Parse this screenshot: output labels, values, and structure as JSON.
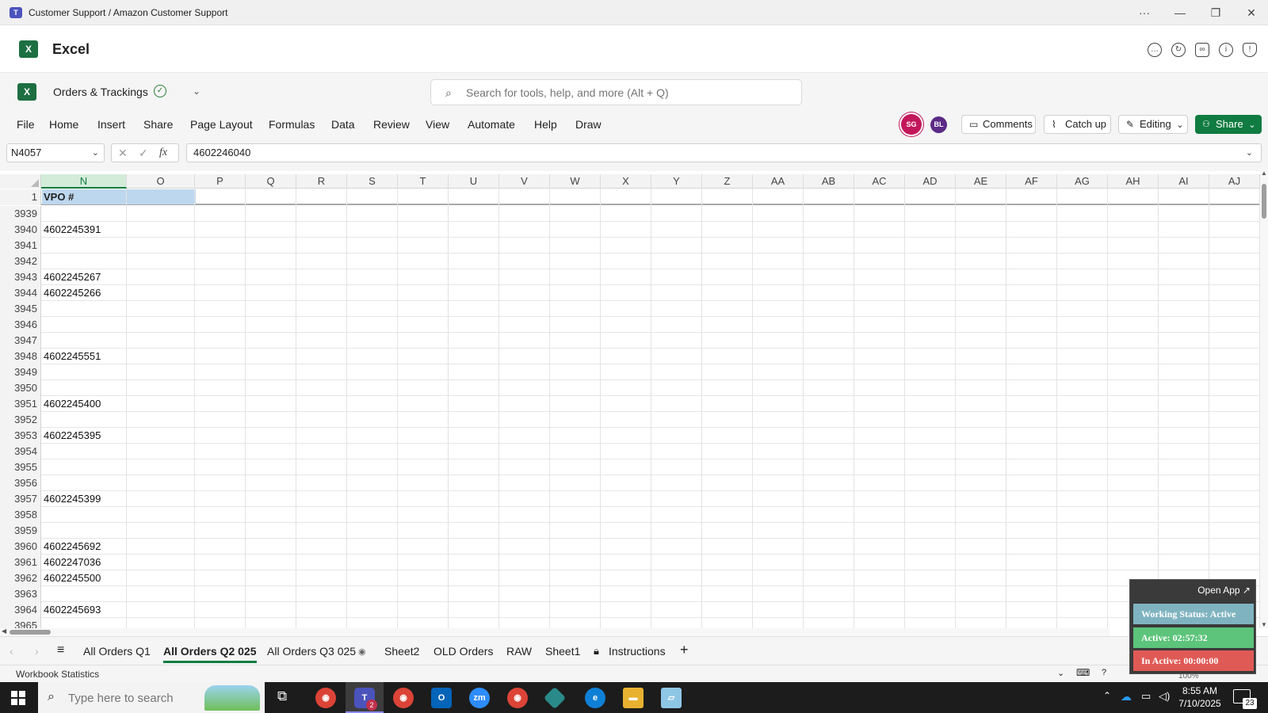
{
  "window": {
    "title": "Customer Support / Amazon Customer Support"
  },
  "app": {
    "name": "Excel"
  },
  "doc": {
    "name": "Orders & Trackings"
  },
  "search": {
    "placeholder": "Search for tools, help, and more (Alt + Q)"
  },
  "ribbon": {
    "tabs": [
      "File",
      "Home",
      "Insert",
      "Share",
      "Page Layout",
      "Formulas",
      "Data",
      "Review",
      "View",
      "Automate",
      "Help",
      "Draw"
    ],
    "avatars": [
      "SG",
      "BL"
    ],
    "comments": "Comments",
    "catchup": "Catch up",
    "editing": "Editing",
    "share": "Share"
  },
  "formula_bar": {
    "name_box": "N4057",
    "value": "4602246040",
    "fx": "fx"
  },
  "grid": {
    "columns": [
      "N",
      "O",
      "P",
      "Q",
      "R",
      "S",
      "T",
      "U",
      "V",
      "W",
      "X",
      "Y",
      "Z",
      "AA",
      "AB",
      "AC",
      "AD",
      "AE",
      "AF",
      "AG",
      "AH",
      "AI",
      "AJ"
    ],
    "header_row": {
      "num": "1",
      "value": "VPO #"
    },
    "rows": [
      {
        "num": "3939",
        "value": ""
      },
      {
        "num": "3940",
        "value": "4602245391"
      },
      {
        "num": "3941",
        "value": ""
      },
      {
        "num": "3942",
        "value": ""
      },
      {
        "num": "3943",
        "value": "4602245267"
      },
      {
        "num": "3944",
        "value": "4602245266"
      },
      {
        "num": "3945",
        "value": ""
      },
      {
        "num": "3946",
        "value": ""
      },
      {
        "num": "3947",
        "value": ""
      },
      {
        "num": "3948",
        "value": "4602245551"
      },
      {
        "num": "3949",
        "value": ""
      },
      {
        "num": "3950",
        "value": ""
      },
      {
        "num": "3951",
        "value": "4602245400"
      },
      {
        "num": "3952",
        "value": ""
      },
      {
        "num": "3953",
        "value": "4602245395"
      },
      {
        "num": "3954",
        "value": ""
      },
      {
        "num": "3955",
        "value": ""
      },
      {
        "num": "3956",
        "value": ""
      },
      {
        "num": "3957",
        "value": "4602245399"
      },
      {
        "num": "3958",
        "value": ""
      },
      {
        "num": "3959",
        "value": ""
      },
      {
        "num": "3960",
        "value": "4602245692"
      },
      {
        "num": "3961",
        "value": "4602247036"
      },
      {
        "num": "3962",
        "value": "4602245500"
      },
      {
        "num": "3963",
        "value": ""
      },
      {
        "num": "3964",
        "value": "4602245693"
      },
      {
        "num": "3965",
        "value": ""
      }
    ]
  },
  "sheets": [
    "All Orders Q1",
    "All Orders Q2 025",
    "All Orders Q3 025",
    "Sheet2",
    "OLD Orders",
    "RAW",
    "Sheet1",
    "Instructions"
  ],
  "active_sheet": "All Orders Q2 025",
  "status": {
    "text": "Workbook Statistics",
    "zoom": "100%"
  },
  "widget": {
    "open_app": "Open App ↗",
    "working_status": "Working Status: Active",
    "active": "Active: 02:57:32",
    "inactive": "In Active: 00:00:00",
    "colors": {
      "status": "#7fb3c0",
      "active": "#5cc47b",
      "inactive": "#e05a55"
    }
  },
  "taskbar": {
    "search_placeholder": "Type here to search",
    "time": "8:55 AM",
    "date": "7/10/2025",
    "notifications": "23",
    "teams_badge": "2"
  },
  "colors": {
    "accent": "#107c41",
    "header_fill": "#bdd7ee"
  }
}
